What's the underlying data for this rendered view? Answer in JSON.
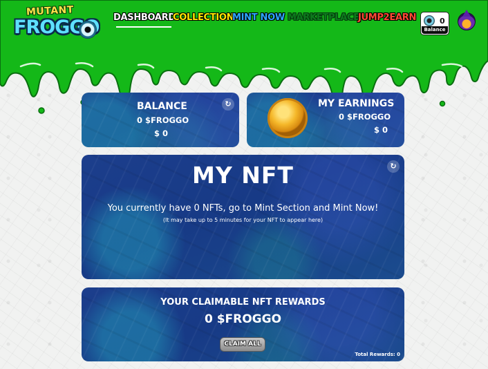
{
  "header": {
    "logo_line1": "MUTANT",
    "logo_line2": "FROGGO",
    "nav": {
      "dashboard": "DASHBOARD",
      "collection": "COLLECTION",
      "mint_now": "MINT NOW",
      "marketplace": "MARKETPLACE",
      "jump2earn": "JUMP2EARN"
    },
    "balance_count": "0",
    "balance_label": "Balance"
  },
  "balance_card": {
    "title": "BALANCE",
    "froggo": "0 $FROGGO",
    "usd": "$ 0"
  },
  "earnings_card": {
    "title": "MY EARNINGS",
    "froggo": "0 $FROGGO",
    "usd": "$ 0"
  },
  "nft_card": {
    "title": "MY NFT",
    "message": "You currently have 0 NFTs, go to Mint Section and Mint Now!",
    "note": "(It may take up to 5 minutes for your NFT to appear here)"
  },
  "rewards_card": {
    "title": "YOUR CLAIMABLE NFT REWARDS",
    "amount": "0 $FROGGO",
    "claim_button": "CLAIM ALL",
    "total_rewards": "Total Rewards: 0"
  },
  "colors": {
    "slime_green": "#18c31c",
    "card_blue": "#1c3e8c",
    "nav_collection": "#ffe600",
    "nav_mint": "#2ea7ff",
    "nav_marketplace": "#0d7a1e",
    "nav_jump": "#ff4a35"
  },
  "icons": [
    "refresh-icon",
    "coin-icon",
    "avatar-icon"
  ]
}
